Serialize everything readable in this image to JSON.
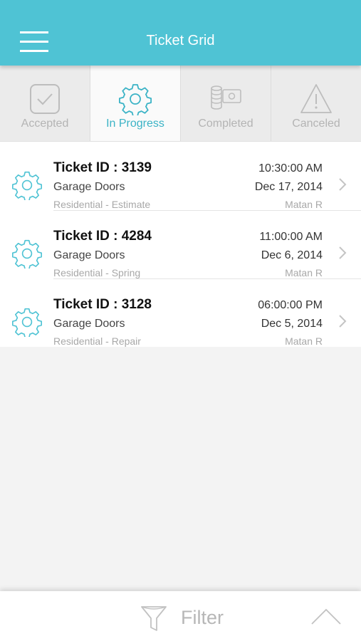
{
  "header": {
    "title": "Ticket Grid"
  },
  "tabs": [
    {
      "label": "Accepted",
      "icon": "check-box-icon",
      "active": false
    },
    {
      "label": "In Progress",
      "icon": "gear-icon",
      "active": true
    },
    {
      "label": "Completed",
      "icon": "money-icon",
      "active": false
    },
    {
      "label": "Canceled",
      "icon": "warning-icon",
      "active": false
    }
  ],
  "tickets": [
    {
      "id": "Ticket ID : 3139",
      "category": "Garage Doors",
      "subtitle": "Residential - Estimate",
      "time": "10:30:00 AM",
      "date": "Dec 17, 2014",
      "user": "Matan R"
    },
    {
      "id": "Ticket ID : 4284",
      "category": "Garage Doors",
      "subtitle": "Residential - Spring",
      "time": "11:00:00 AM",
      "date": "Dec 6, 2014",
      "user": "Matan R"
    },
    {
      "id": "Ticket ID : 3128",
      "category": "Garage Doors",
      "subtitle": "Residential - Repair",
      "time": "06:00:00 PM",
      "date": "Dec 5, 2014",
      "user": "Matan R"
    }
  ],
  "footer": {
    "filter_label": "Filter"
  },
  "colors": {
    "accent": "#4fc3d4",
    "active_tab_text": "#3bb3c6",
    "inactive_tab_text": "#b4b4b4"
  }
}
